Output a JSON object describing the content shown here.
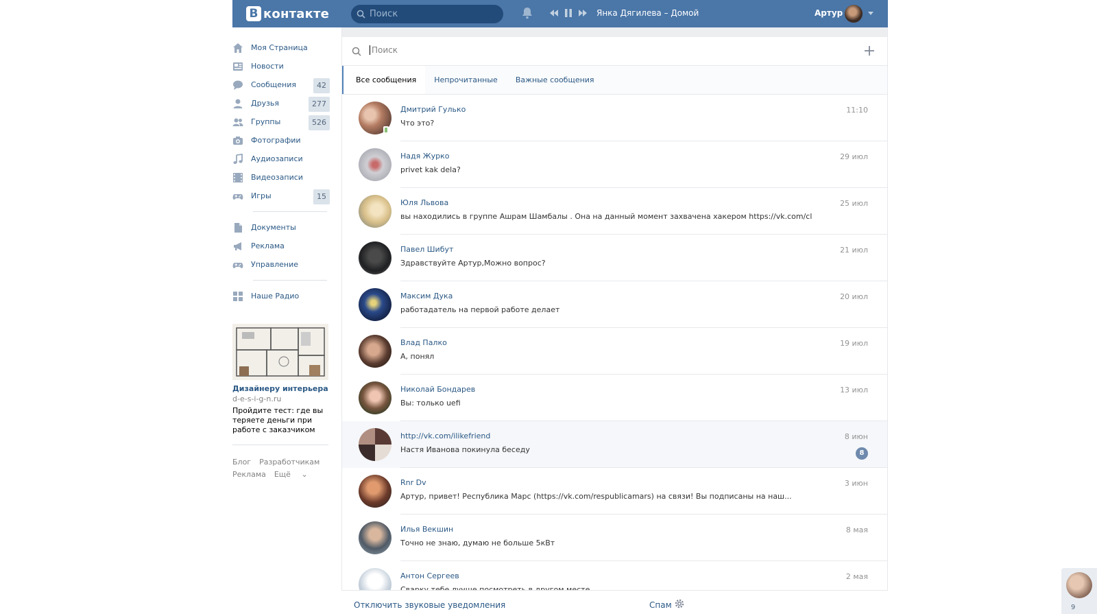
{
  "header": {
    "logo_letter": "В",
    "logo_text": "контакте",
    "search_placeholder": "Поиск",
    "track": "Янка Дягилева – Домой",
    "user_name": "Артур"
  },
  "nav": {
    "items": [
      {
        "label": "Моя Страница",
        "icon": "home-icon",
        "count": ""
      },
      {
        "label": "Новости",
        "icon": "news-icon",
        "count": ""
      },
      {
        "label": "Сообщения",
        "icon": "chat-bubble-icon",
        "count": "42"
      },
      {
        "label": "Друзья",
        "icon": "person-icon",
        "count": "277"
      },
      {
        "label": "Группы",
        "icon": "people-icon",
        "count": "526"
      },
      {
        "label": "Фотографии",
        "icon": "camera-icon",
        "count": ""
      },
      {
        "label": "Аудиозаписи",
        "icon": "music-note-icon",
        "count": ""
      },
      {
        "label": "Видеозаписи",
        "icon": "film-icon",
        "count": ""
      },
      {
        "label": "Игры",
        "icon": "gamepad-icon",
        "count": "15"
      }
    ],
    "items2": [
      {
        "label": "Документы",
        "icon": "document-icon"
      },
      {
        "label": "Реклама",
        "icon": "megaphone-icon"
      },
      {
        "label": "Управление",
        "icon": "gamepad-icon"
      }
    ],
    "items3": [
      {
        "label": "Наше Радио",
        "icon": "app-grid-icon"
      }
    ]
  },
  "ad": {
    "title": "Дизайнеру интерьера",
    "domain": "d-e-s-i-g-n.ru",
    "text": "Пройдите тест: где вы теряете деньги при работе с заказчиком"
  },
  "footer": {
    "blog": "Блог",
    "dev": "Разработчикам",
    "ads": "Реклама",
    "more": "Ещё"
  },
  "im": {
    "search_placeholder": "Поиск",
    "tabs": [
      "Все сообщения",
      "Непрочитанные",
      "Важные сообщения"
    ],
    "dialogs": [
      {
        "name": "Дмитрий Гулько",
        "msg": "Что это?",
        "date": "11:10",
        "badge": ""
      },
      {
        "name": "Надя Журко",
        "msg": "privet kak dela?",
        "date": "29 июл",
        "badge": ""
      },
      {
        "name": "Юля Львова",
        "msg": "вы находились в группе Ашрам Шамбалы . Она на данный момент захвачена хакером https://vk.com/club.ashra...",
        "date": "25 июл",
        "badge": ""
      },
      {
        "name": "Павел Шибут",
        "msg": "Здравствуйте Артур,Можно вопрос?",
        "date": "21 июл",
        "badge": ""
      },
      {
        "name": "Максим Дука",
        "msg": "работадатель на первой работе делает",
        "date": "20 июл",
        "badge": ""
      },
      {
        "name": "Влад Палко",
        "msg": "А, понял",
        "date": "19 июл",
        "badge": ""
      },
      {
        "name": "Николай Бондарев",
        "msg": "Вы: только uefi",
        "date": "13 июл",
        "badge": ""
      },
      {
        "name": "http://vk.com/ilikefriend",
        "msg": "Настя Иванова покинула беседу",
        "date": "8 июн",
        "badge": "8"
      },
      {
        "name": "Rnr Dv",
        "msg": "Артур, привет! Республика Марс (https://vk.com/respublicamars) на связи! Вы подписаны на наш...",
        "date": "3 июн",
        "badge": ""
      },
      {
        "name": "Илья Векшин",
        "msg": "Точно не знаю, думаю не больше 5кВт",
        "date": "8 мая",
        "badge": ""
      },
      {
        "name": "Антон Сергеев",
        "msg": "Сварку тебе лучше посмотреть в другом месте",
        "date": "2 мая",
        "badge": ""
      }
    ],
    "sound_toggle": "Отключить звуковые уведомления",
    "spam": "Спам"
  },
  "chat_widget": {
    "count": "9"
  }
}
